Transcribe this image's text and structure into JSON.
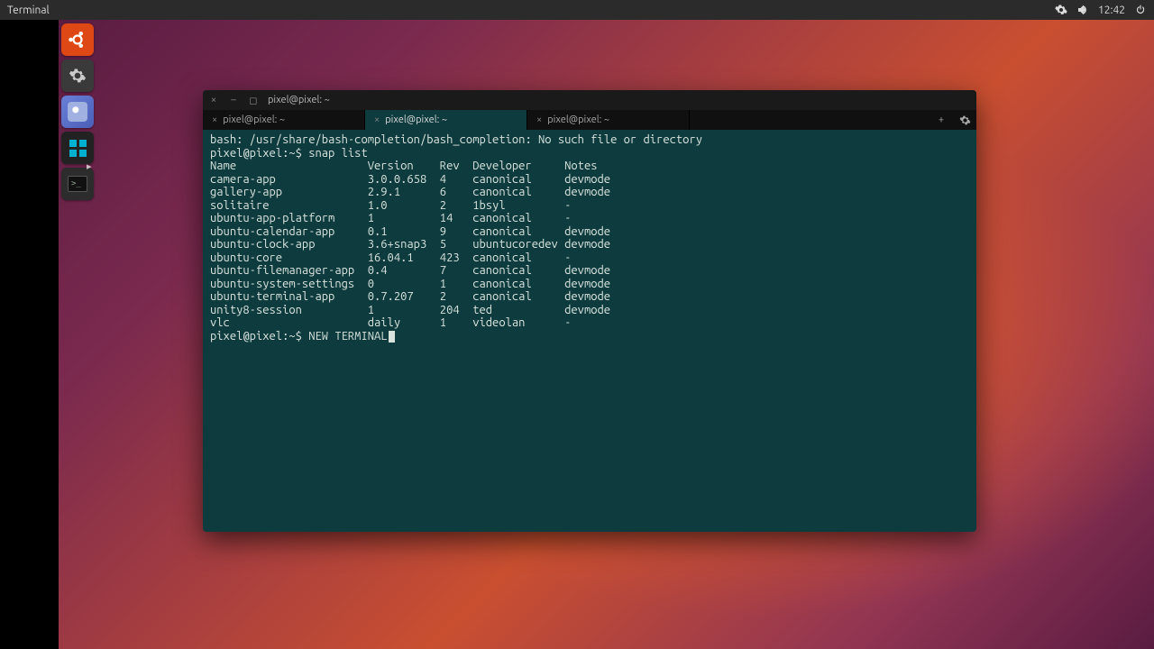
{
  "menubar": {
    "app_label": "Terminal",
    "clock": "12:42"
  },
  "launcher": {
    "items": [
      {
        "name": "ubuntu-bfb"
      },
      {
        "name": "system-settings"
      },
      {
        "name": "photos-app"
      },
      {
        "name": "tiles-app"
      },
      {
        "name": "terminal-app"
      }
    ],
    "pip_glyph": "▸"
  },
  "terminal_window": {
    "title": "pixel@pixel: ~",
    "win_buttons": {
      "close": "×",
      "min": "–",
      "max": "◻"
    },
    "tabs": [
      {
        "label": "pixel@pixel: ~",
        "active": false
      },
      {
        "label": "pixel@pixel: ~",
        "active": true
      },
      {
        "label": "pixel@pixel: ~",
        "active": false
      }
    ],
    "add_tab_glyph": "+",
    "settings_glyph": "⚙"
  },
  "terminal": {
    "error_line": "bash: /usr/share/bash-completion/bash_completion: No such file or directory",
    "prompt": "pixel@pixel:~$",
    "command": "snap list",
    "columns": [
      "Name",
      "Version",
      "Rev",
      "Developer",
      "Notes"
    ],
    "rows": [
      {
        "name": "camera-app",
        "version": "3.0.0.658",
        "rev": "4",
        "developer": "canonical",
        "notes": "devmode"
      },
      {
        "name": "gallery-app",
        "version": "2.9.1",
        "rev": "6",
        "developer": "canonical",
        "notes": "devmode"
      },
      {
        "name": "solitaire",
        "version": "1.0",
        "rev": "2",
        "developer": "1bsyl",
        "notes": "-"
      },
      {
        "name": "ubuntu-app-platform",
        "version": "1",
        "rev": "14",
        "developer": "canonical",
        "notes": "-"
      },
      {
        "name": "ubuntu-calendar-app",
        "version": "0.1",
        "rev": "9",
        "developer": "canonical",
        "notes": "devmode"
      },
      {
        "name": "ubuntu-clock-app",
        "version": "3.6+snap3",
        "rev": "5",
        "developer": "ubuntucoredev",
        "notes": "devmode"
      },
      {
        "name": "ubuntu-core",
        "version": "16.04.1",
        "rev": "423",
        "developer": "canonical",
        "notes": "-"
      },
      {
        "name": "ubuntu-filemanager-app",
        "version": "0.4",
        "rev": "7",
        "developer": "canonical",
        "notes": "devmode"
      },
      {
        "name": "ubuntu-system-settings",
        "version": "0",
        "rev": "1",
        "developer": "canonical",
        "notes": "devmode"
      },
      {
        "name": "ubuntu-terminal-app",
        "version": "0.7.207",
        "rev": "2",
        "developer": "canonical",
        "notes": "devmode"
      },
      {
        "name": "unity8-session",
        "version": "1",
        "rev": "204",
        "developer": "ted",
        "notes": "devmode"
      },
      {
        "name": "vlc",
        "version": "daily",
        "rev": "1",
        "developer": "videolan",
        "notes": "-"
      }
    ],
    "current_input": "NEW TERMINAL",
    "col_widths": {
      "name": 24,
      "version": 11,
      "rev": 5,
      "developer": 14
    }
  }
}
